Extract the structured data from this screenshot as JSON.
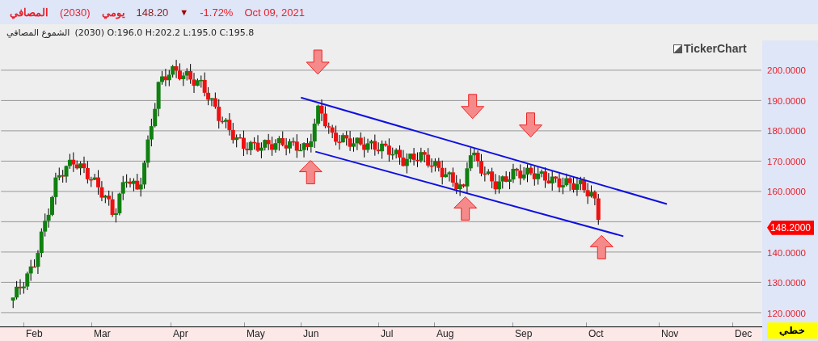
{
  "header": {
    "name": "المصافي",
    "code": "(2030)",
    "period": "يومي",
    "price": "148.20",
    "direction_icon": "▼",
    "change": "-1.72%",
    "date": "Oct 09, 2021"
  },
  "info_bar": {
    "name": "الشموع المصافي",
    "values": "(2030) O:196.0 H:202.2 L:195.0 C:195.8"
  },
  "logo": {
    "text": "TickerChart"
  },
  "price_axis": {
    "labels": [
      "200.0000",
      "190.0000",
      "180.0000",
      "170.0000",
      "160.0000",
      "140.0000",
      "130.0000",
      "120.0000"
    ],
    "last_price": "148.2000"
  },
  "time_axis": {
    "labels": [
      "Feb",
      "Mar",
      "Apr",
      "May",
      "Jun",
      "Jul",
      "Aug",
      "Sep",
      "Oct",
      "Nov",
      "Dec"
    ]
  },
  "chart_type_button": {
    "label": "خطي"
  }
}
